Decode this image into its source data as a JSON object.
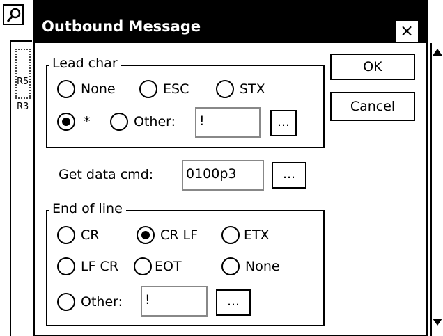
{
  "background": {
    "list_item_a": "R5",
    "list_item_b": "R3"
  },
  "dialog": {
    "title": "Outbound Message",
    "close_label": "×",
    "ok_label": "OK",
    "cancel_label": "Cancel",
    "lead_char": {
      "legend": "Lead char",
      "options": [
        "None",
        "ESC",
        "STX",
        "*",
        "Other:"
      ],
      "selected": "*",
      "other_value": "!",
      "browse_label": "..."
    },
    "get_data_cmd": {
      "label": "Get data cmd:",
      "value": "0100p3",
      "browse_label": "..."
    },
    "end_of_line": {
      "legend": "End of line",
      "options": [
        "CR",
        "CR LF",
        "ETX",
        "LF CR",
        "EOT",
        "None",
        "Other:"
      ],
      "selected": "CR LF",
      "other_value": "!",
      "browse_label": "..."
    }
  }
}
